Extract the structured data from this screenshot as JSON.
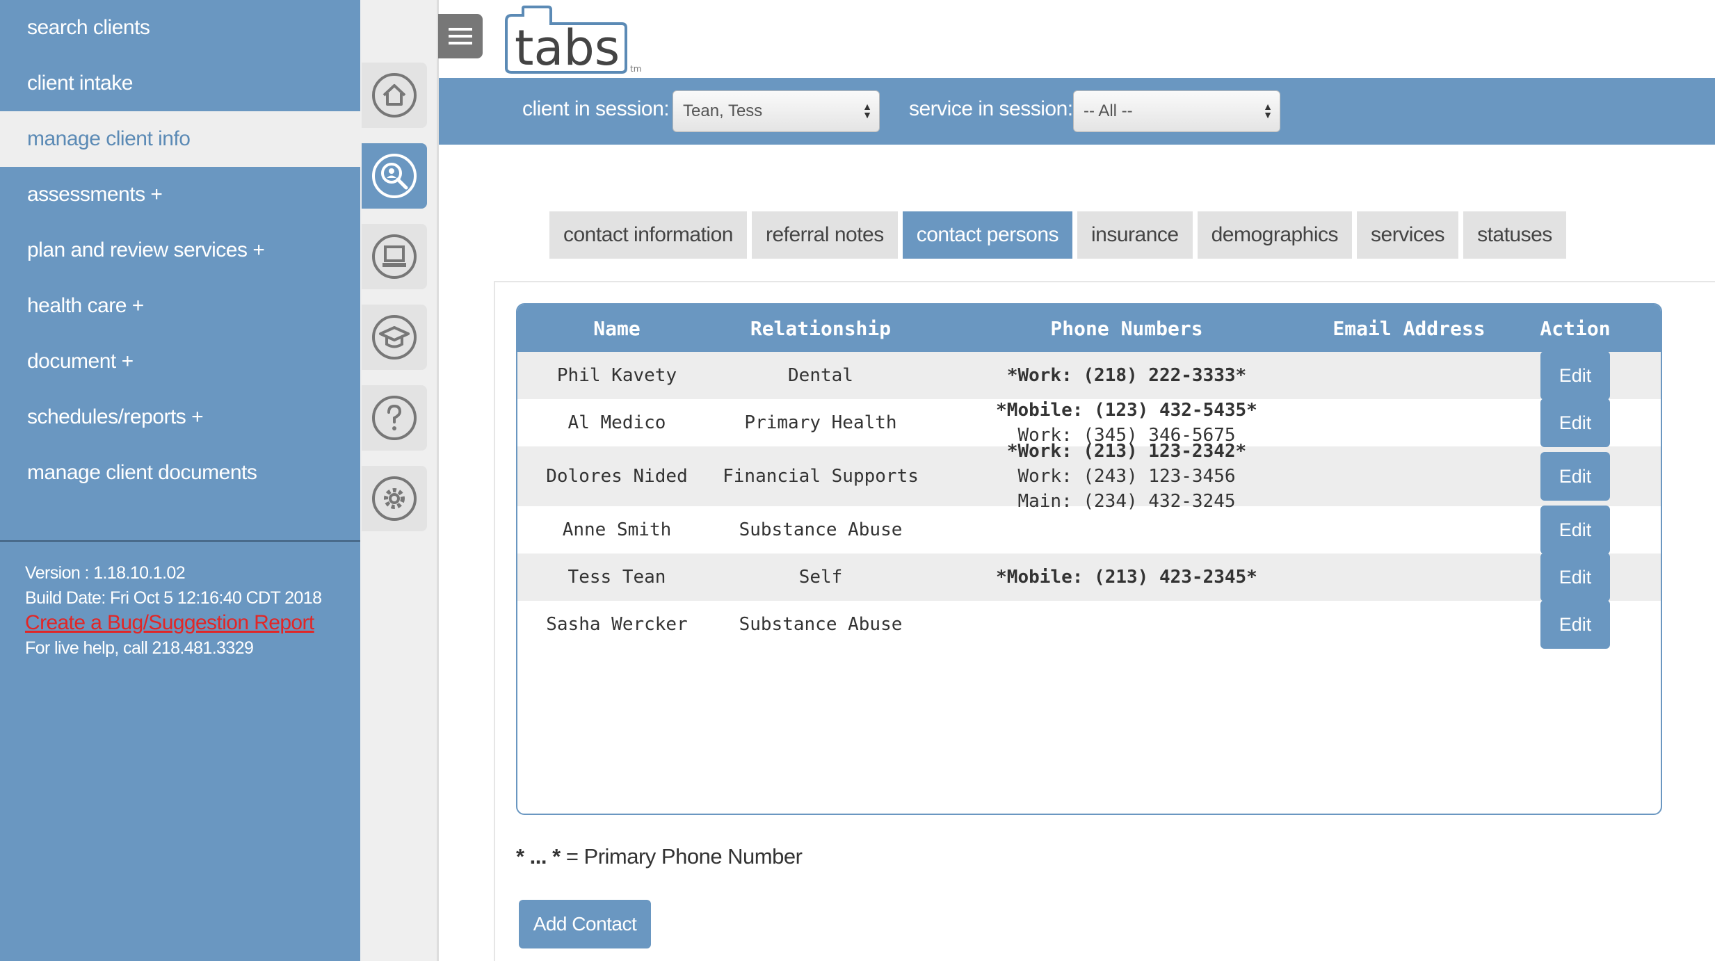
{
  "sidebar": {
    "items": [
      {
        "label": "search clients",
        "active": false
      },
      {
        "label": "client intake",
        "active": false
      },
      {
        "label": "manage client info",
        "active": true
      },
      {
        "label": "assessments +",
        "active": false
      },
      {
        "label": "plan and review services +",
        "active": false
      },
      {
        "label": "health care +",
        "active": false
      },
      {
        "label": "document +",
        "active": false
      },
      {
        "label": "schedules/reports +",
        "active": false
      },
      {
        "label": "manage client documents",
        "active": false
      }
    ],
    "version": "Version : 1.18.10.1.02",
    "build_date": "Build Date: Fri Oct 5 12:16:40 CDT 2018",
    "bug_link": "Create a Bug/Suggestion Report",
    "help_text": "For live help, call 218.481.3329"
  },
  "icon_rail": {
    "icons": [
      "home-icon",
      "search-client-icon",
      "laptop-icon",
      "graduation-cap-icon",
      "help-icon",
      "settings-icon"
    ],
    "active": "search-client-icon"
  },
  "header": {
    "logo_text": "tabs",
    "logo_tm": "tm",
    "client_label": "client in session:",
    "client_value": "Tean, Tess",
    "service_label": "service in session:",
    "service_value": "-- All --"
  },
  "tabs": [
    {
      "label": "contact information",
      "active": false
    },
    {
      "label": "referral notes",
      "active": false
    },
    {
      "label": "contact persons",
      "active": true
    },
    {
      "label": "insurance",
      "active": false
    },
    {
      "label": "demographics",
      "active": false
    },
    {
      "label": "services",
      "active": false
    },
    {
      "label": "statuses",
      "active": false
    }
  ],
  "table": {
    "headers": {
      "name": "Name",
      "relationship": "Relationship",
      "phones": "Phone Numbers",
      "email": "Email Address",
      "action": "Action"
    },
    "edit_label": "Edit",
    "rows": [
      {
        "name": "Phil Kavety",
        "relationship": "Dental",
        "phones": [
          {
            "text": "*Work: (218) 222-3333*",
            "primary": true
          }
        ],
        "email": ""
      },
      {
        "name": "Al Medico",
        "relationship": "Primary Health",
        "phones": [
          {
            "text": "*Mobile: (123) 432-5435*",
            "primary": true
          },
          {
            "text": "Work: (345) 346-5675",
            "primary": false
          }
        ],
        "email": ""
      },
      {
        "name": "Dolores Nided",
        "relationship": "Financial Supports",
        "phones": [
          {
            "text": "*Work: (213) 123-2342*",
            "primary": true
          },
          {
            "text": "Work: (243) 123-3456",
            "primary": false
          },
          {
            "text": "Main: (234) 432-3245",
            "primary": false
          }
        ],
        "email": ""
      },
      {
        "name": "Anne Smith",
        "relationship": "Substance Abuse",
        "phones": [],
        "email": ""
      },
      {
        "name": "Tess Tean",
        "relationship": "Self",
        "phones": [
          {
            "text": "*Mobile: (213) 423-2345*",
            "primary": true
          }
        ],
        "email": ""
      },
      {
        "name": "Sasha Wercker",
        "relationship": "Substance Abuse",
        "phones": [],
        "email": ""
      }
    ]
  },
  "legend": {
    "marker": "* ... *",
    "text": " = Primary Phone Number"
  },
  "add_contact_label": "Add Contact",
  "colors": {
    "accent": "#6a97c1",
    "link": "#e22626"
  }
}
